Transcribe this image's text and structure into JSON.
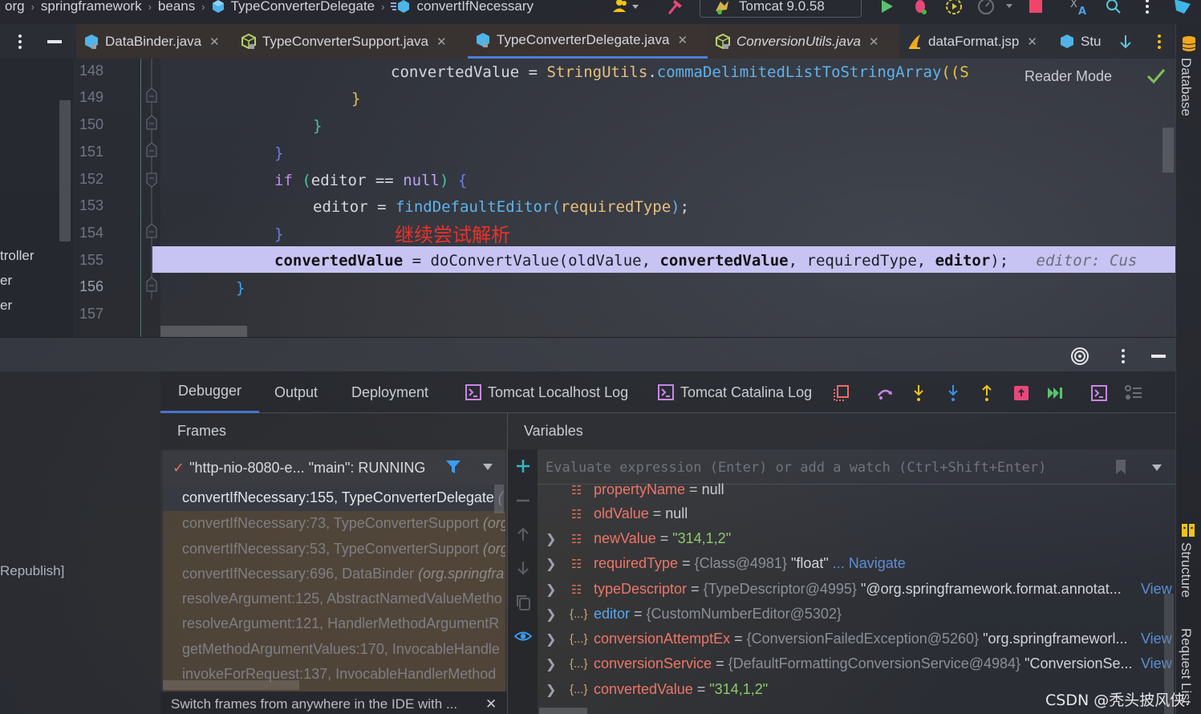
{
  "breadcrumbs": [
    {
      "label": "org"
    },
    {
      "label": "springframework"
    },
    {
      "label": "beans"
    },
    {
      "label": "TypeConverterDelegate",
      "icon": "class-icon"
    },
    {
      "label": "convertIfNecessary",
      "icon": "method-icon"
    }
  ],
  "toolbar": {
    "run_config": "Tomcat 9.0.58",
    "icons": [
      "vcs-users-icon",
      "build-hammer-icon",
      "run-icon",
      "debug-icon",
      "coverage-icon",
      "profiler-icon",
      "stop-icon",
      "translate-icon",
      "search-icon",
      "more-icon",
      "plugin-icon"
    ]
  },
  "editor_tabs": [
    {
      "label": "DataBinder.java",
      "icon": "java-class-icon",
      "active": false
    },
    {
      "label": "TypeConverterSupport.java",
      "icon": "java-abstract-icon",
      "active": false
    },
    {
      "label": "TypeConverterDelegate.java",
      "icon": "java-class-icon",
      "active": true
    },
    {
      "label": "ConversionUtils.java",
      "icon": "java-abstract-icon",
      "active": false,
      "italic": true
    },
    {
      "label": "dataFormat.jsp",
      "icon": "jsp-icon",
      "active": false
    },
    {
      "label": "Stu",
      "icon": "java-class-icon",
      "active": false,
      "truncated": true
    }
  ],
  "project_panel": {
    "items": [
      "troller",
      "er",
      "er"
    ]
  },
  "editor": {
    "line_numbers": [
      "148",
      "149",
      "150",
      "151",
      "152",
      "153",
      "154",
      "155",
      "156",
      "157"
    ],
    "current_line": "155",
    "lines": {
      "l148": {
        "var": "convertedValue",
        "eq": " = ",
        "cls": "StringUtils",
        "dot": ".",
        "fn": "commaDelimitedListToStringArray",
        "tail": "((S"
      },
      "l149": "}",
      "l150": "}",
      "l151": "}",
      "l152": {
        "kw": "if",
        "open": " (",
        "var": "editor",
        "op": " == ",
        "nul": "null",
        "close": ")",
        "brace": " {"
      },
      "l153": {
        "var": "editor",
        "eq": " = ",
        "fn": "findDefaultEditor",
        "open": "(",
        "arg": "requiredType",
        "close": ")",
        "semi": ";"
      },
      "l154": "}",
      "l155": {
        "var": "convertedValue",
        "eq": " = ",
        "fn": "doConvertValue(oldValue, ",
        "arg2": "convertedValue",
        "mid": ", requiredType, ",
        "arg4": "editor",
        "end": ");",
        "hint": "editor: Cus"
      },
      "l156": "}"
    },
    "annotation": "继续尝试解析",
    "reader_mode": "Reader Mode"
  },
  "right_strip": {
    "database": "Database",
    "structure": "Structure",
    "request_list": "Request List"
  },
  "debug": {
    "tabs": [
      {
        "label": "Debugger",
        "active": true
      },
      {
        "label": "Output"
      },
      {
        "label": "Deployment"
      },
      {
        "label": "Tomcat Localhost Log",
        "icon": "console-icon"
      },
      {
        "label": "Tomcat Catalina Log",
        "icon": "console-icon"
      }
    ],
    "left_text": "Republish]",
    "frames_title": "Frames",
    "thread": "\"http-nio-8080-e... \"main\": RUNNING",
    "frames": [
      {
        "method": "convertIfNecessary:155, TypeConverterDelegate",
        "pkg": "(",
        "selected": true
      },
      {
        "method": "convertIfNecessary:73, TypeConverterSupport",
        "pkg": "(org"
      },
      {
        "method": "convertIfNecessary:53, TypeConverterSupport",
        "pkg": "(org"
      },
      {
        "method": "convertIfNecessary:696, DataBinder",
        "pkg": "(org.springfra"
      },
      {
        "method": "resolveArgument:125, AbstractNamedValueMetho",
        "pkg": ""
      },
      {
        "method": "resolveArgument:121, HandlerMethodArgumentR",
        "pkg": ""
      },
      {
        "method": "getMethodArgumentValues:170, InvocableHandle",
        "pkg": ""
      },
      {
        "method": "invokeForRequest:137, InvocableHandlerMethod",
        "pkg": ""
      }
    ],
    "tip": "Switch frames from anywhere in the IDE with ...",
    "variables_title": "Variables",
    "eval_placeholder": "Evaluate expression (Enter) or add a watch (Ctrl+Shift+Enter)",
    "variables": [
      {
        "name": "propertyName",
        "value": "null",
        "type": "field",
        "expandable": false
      },
      {
        "name": "oldValue",
        "value": "null",
        "type": "field",
        "expandable": false
      },
      {
        "name": "newValue",
        "value": "\"314,1,2\"",
        "type": "field",
        "expandable": true,
        "kind": "string"
      },
      {
        "name": "requiredType",
        "obj": "{Class@4981}",
        "text": " \"float\"",
        "link": " ... Navigate",
        "type": "field",
        "expandable": true
      },
      {
        "name": "typeDescriptor",
        "obj": "{TypeDescriptor@4995}",
        "text": " \"@org.springframework.format.annotat...",
        "view": "View",
        "type": "field",
        "expandable": true
      },
      {
        "name": "editor",
        "obj": "{CustomNumberEditor@5302}",
        "type": "local",
        "expandable": true,
        "blue": true
      },
      {
        "name": "conversionAttemptEx",
        "obj": "{ConversionFailedException@5260}",
        "text": " \"org.springframeworl...",
        "view": "View",
        "type": "local",
        "expandable": true
      },
      {
        "name": "conversionService",
        "obj": "{DefaultFormattingConversionService@4984}",
        "text": " \"ConversionSe...",
        "view": "View",
        "type": "local",
        "expandable": true
      },
      {
        "name": "convertedValue",
        "value": "\"314,1,2\"",
        "type": "local",
        "expandable": true,
        "kind": "string"
      }
    ]
  },
  "watermark": "CSDN @秃头披风侠."
}
